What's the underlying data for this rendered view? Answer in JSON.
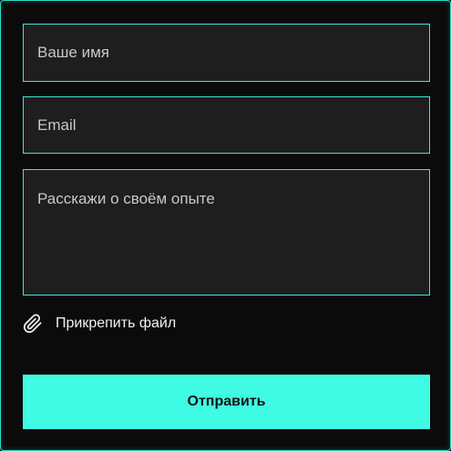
{
  "form": {
    "name_placeholder": "Ваше имя",
    "email_placeholder": "Email",
    "story_placeholder": "Расскажи о своём опыте",
    "attach_label": "Прикрепить файл",
    "attach_icon": "paperclip-icon",
    "submit_label": "Отправить"
  },
  "colors": {
    "accent": "#3ffbe3",
    "border": "#3ee6d6",
    "field_bg": "#1e1e1e",
    "page_bg": "#0b0b0b"
  }
}
